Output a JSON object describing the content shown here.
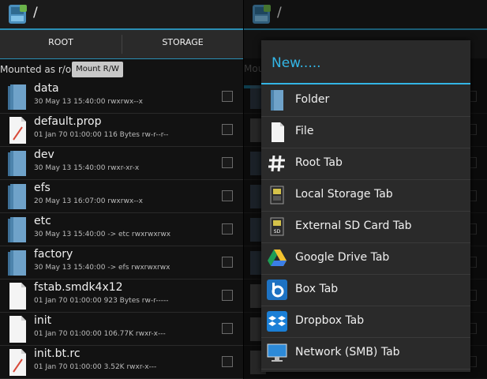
{
  "left": {
    "path": "/",
    "tabs": [
      {
        "label": "ROOT"
      },
      {
        "label": "STORAGE"
      }
    ],
    "mounted_text": "Mounted as r/o",
    "mount_button": "Mount R/W",
    "files": [
      {
        "name": "data",
        "meta": "30 May 13 15:40:00   rwxrwx--x",
        "type": "folder"
      },
      {
        "name": "default.prop",
        "meta": "01 Jan 70 01:00:00  116 Bytes  rw-r--r--",
        "type": "file-red"
      },
      {
        "name": "dev",
        "meta": "30 May 13 15:40:00   rwxr-xr-x",
        "type": "folder"
      },
      {
        "name": "efs",
        "meta": "20 May 13 16:07:00   rwxrwx--x",
        "type": "folder"
      },
      {
        "name": "etc",
        "meta": "30 May 13 15:40:00  -> etc  rwxrwxrwx",
        "type": "folder"
      },
      {
        "name": "factory",
        "meta": "30 May 13 15:40:00  -> efs  rwxrwxrwx",
        "type": "folder"
      },
      {
        "name": "fstab.smdk4x12",
        "meta": "01 Jan 70 01:00:00  923 Bytes  rw-r-----",
        "type": "file"
      },
      {
        "name": "init",
        "meta": "01 Jan 70 01:00:00  106.77K  rwxr-x---",
        "type": "file"
      },
      {
        "name": "init.bt.rc",
        "meta": "01 Jan 70 01:00:00  3.52K  rwxr-x---",
        "type": "file-red"
      }
    ]
  },
  "right": {
    "path": "/",
    "ghost_text": "Mou"
  },
  "dialog": {
    "title": "New.....",
    "items": [
      {
        "label": "Folder",
        "icon": "folder-icon"
      },
      {
        "label": "File",
        "icon": "file-icon"
      },
      {
        "label": "Root Tab",
        "icon": "hash-icon"
      },
      {
        "label": "Local Storage Tab",
        "icon": "sd-card-icon"
      },
      {
        "label": "External SD Card Tab",
        "icon": "external-sd-icon"
      },
      {
        "label": "Google Drive Tab",
        "icon": "google-drive-icon"
      },
      {
        "label": "Box Tab",
        "icon": "box-icon"
      },
      {
        "label": "Dropbox Tab",
        "icon": "dropbox-icon"
      },
      {
        "label": "Network (SMB) Tab",
        "icon": "network-monitor-icon"
      }
    ]
  },
  "colors": {
    "accent": "#33b5e5",
    "background": "#121212"
  }
}
